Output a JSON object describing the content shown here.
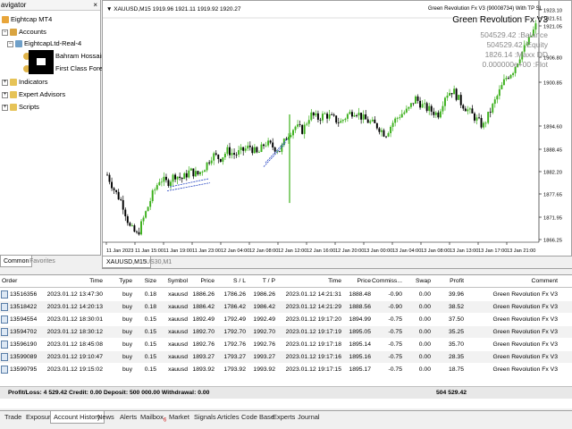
{
  "navigator": {
    "title": "avigator",
    "close": "×",
    "items": [
      {
        "label": "Eightcap MT4"
      },
      {
        "label": "Accounts"
      },
      {
        "label": "EightcapLtd-Real-4"
      },
      {
        "label": "Bahram Hossainian f"
      },
      {
        "label": "First Class Forex Fund"
      },
      {
        "label": "Indicators"
      },
      {
        "label": "Expert Advisors"
      },
      {
        "label": "Scripts"
      }
    ],
    "tabs": [
      "Common",
      "Favorites"
    ]
  },
  "chart": {
    "header": "▼ XAUUSD,M15  1919.96 1921.11 1919.92 1920.27",
    "ea_label": "Green Revolution Fx V3 (90008734) With TP SL",
    "ea_title": "Green Revolution Fx V3",
    "stats": [
      {
        "value": "504529.42",
        "label": ":Balance"
      },
      {
        "value": "504529.42",
        "label": ":Equity"
      },
      {
        "value": "1826.14",
        "label": ":Maxx DD"
      },
      {
        "value": "0.000000e+00",
        "label": ":Flot"
      }
    ],
    "price_labels": [
      "1923.10",
      "1921.51",
      "1921.05",
      "1906.80",
      "1900.85",
      "1894.60",
      "1888.45",
      "1882.20",
      "1877.65",
      "1871.95",
      "1866.25"
    ],
    "time_labels": [
      "11 Jan 2023",
      "11 Jan 15:00",
      "11 Jan 19:00",
      "11 Jan 23:00",
      "12 Jan 04:00",
      "12 Jan 08:00",
      "12 Jan 12:00",
      "12 Jan 16:00",
      "12 Jan 20:00",
      "13 Jan 00:00",
      "13 Jan 04:00",
      "13 Jan 08:00",
      "13 Jan 13:00",
      "13 Jan 17:00",
      "13 Jan 21:00"
    ],
    "tabs": [
      "XAUUSD,M15",
      "US30,M1"
    ],
    "colors": {
      "up": "#3cb01c",
      "down": "#000000",
      "grid": "#e6e6e6"
    }
  },
  "chart_data": {
    "type": "candlestick",
    "title": "XAUUSD,M15",
    "ylim": [
      1866.25,
      1923.1
    ],
    "series": [
      {
        "name": "XAUUSD,M15",
        "close_path": [
          1883,
          1879,
          1876,
          1870,
          1868,
          1873,
          1878,
          1882,
          1881,
          1883,
          1882,
          1884,
          1883,
          1885,
          1888,
          1887,
          1889,
          1888,
          1889,
          1890,
          1888,
          1891,
          1890,
          1889,
          1893,
          1895,
          1894,
          1898,
          1897,
          1898,
          1897,
          1896,
          1898,
          1899,
          1897,
          1896,
          1895,
          1893,
          1896,
          1898,
          1899,
          1902,
          1900,
          1899,
          1898,
          1903,
          1904,
          1901,
          1899,
          1897,
          1895,
          1899,
          1903,
          1907,
          1909,
          1913,
          1916,
          1920
        ]
      }
    ]
  },
  "table": {
    "headers": [
      "Order",
      "Time",
      "Type",
      "Size",
      "Symbol",
      "Price",
      "S / L",
      "T / P",
      "Time",
      "Price",
      "Commiss...",
      "Swap",
      "Profit",
      "Comment"
    ],
    "rows": [
      [
        "13516356",
        "2023.01.12 13:47:30",
        "buy",
        "0.18",
        "xauusd",
        "1886.26",
        "1786.26",
        "1986.26",
        "2023.01.12 14:21:31",
        "1888.48",
        "-0.90",
        "0.00",
        "39.96",
        "Green Revolution Fx V3"
      ],
      [
        "13518422",
        "2023.01.12 14:20:13",
        "buy",
        "0.18",
        "xauusd",
        "1886.42",
        "1786.42",
        "1986.42",
        "2023.01.12 14:21:29",
        "1888.56",
        "-0.90",
        "0.00",
        "38.52",
        "Green Revolution Fx V3"
      ],
      [
        "13594554",
        "2023.01.12 18:30:01",
        "buy",
        "0.15",
        "xauusd",
        "1892.49",
        "1792.49",
        "1992.49",
        "2023.01.12 19:17:20",
        "1894.99",
        "-0.75",
        "0.00",
        "37.50",
        "Green Revolution Fx V3"
      ],
      [
        "13594702",
        "2023.01.12 18:30:12",
        "buy",
        "0.15",
        "xauusd",
        "1892.70",
        "1792.70",
        "1992.70",
        "2023.01.12 19:17:19",
        "1895.05",
        "-0.75",
        "0.00",
        "35.25",
        "Green Revolution Fx V3"
      ],
      [
        "13596190",
        "2023.01.12 18:45:08",
        "buy",
        "0.15",
        "xauusd",
        "1892.76",
        "1792.76",
        "1992.76",
        "2023.01.12 19:17:18",
        "1895.14",
        "-0.75",
        "0.00",
        "35.70",
        "Green Revolution Fx V3"
      ],
      [
        "13599089",
        "2023.01.12 19:10:47",
        "buy",
        "0.15",
        "xauusd",
        "1893.27",
        "1793.27",
        "1993.27",
        "2023.01.12 19:17:16",
        "1895.16",
        "-0.75",
        "0.00",
        "28.35",
        "Green Revolution Fx V3"
      ],
      [
        "13599795",
        "2023.01.12 19:15:02",
        "buy",
        "0.15",
        "xauusd",
        "1893.92",
        "1793.92",
        "1993.92",
        "2023.01.12 19:17:15",
        "1895.17",
        "-0.75",
        "0.00",
        "18.75",
        "Green Revolution Fx V3"
      ]
    ],
    "summary": "Profit/Loss: 4 529.42  Credit: 0.00  Deposit: 500 000.00  Withdrawal: 0.00",
    "summary_total": "504 529.42"
  },
  "bottom_tabs": [
    "Trade",
    "Exposure",
    "Account History",
    "News",
    "Alerts",
    "Mailbox",
    "Market",
    "Signals",
    "Articles",
    "Code Base",
    "Experts",
    "Journal"
  ],
  "mailbox_badge": "6"
}
